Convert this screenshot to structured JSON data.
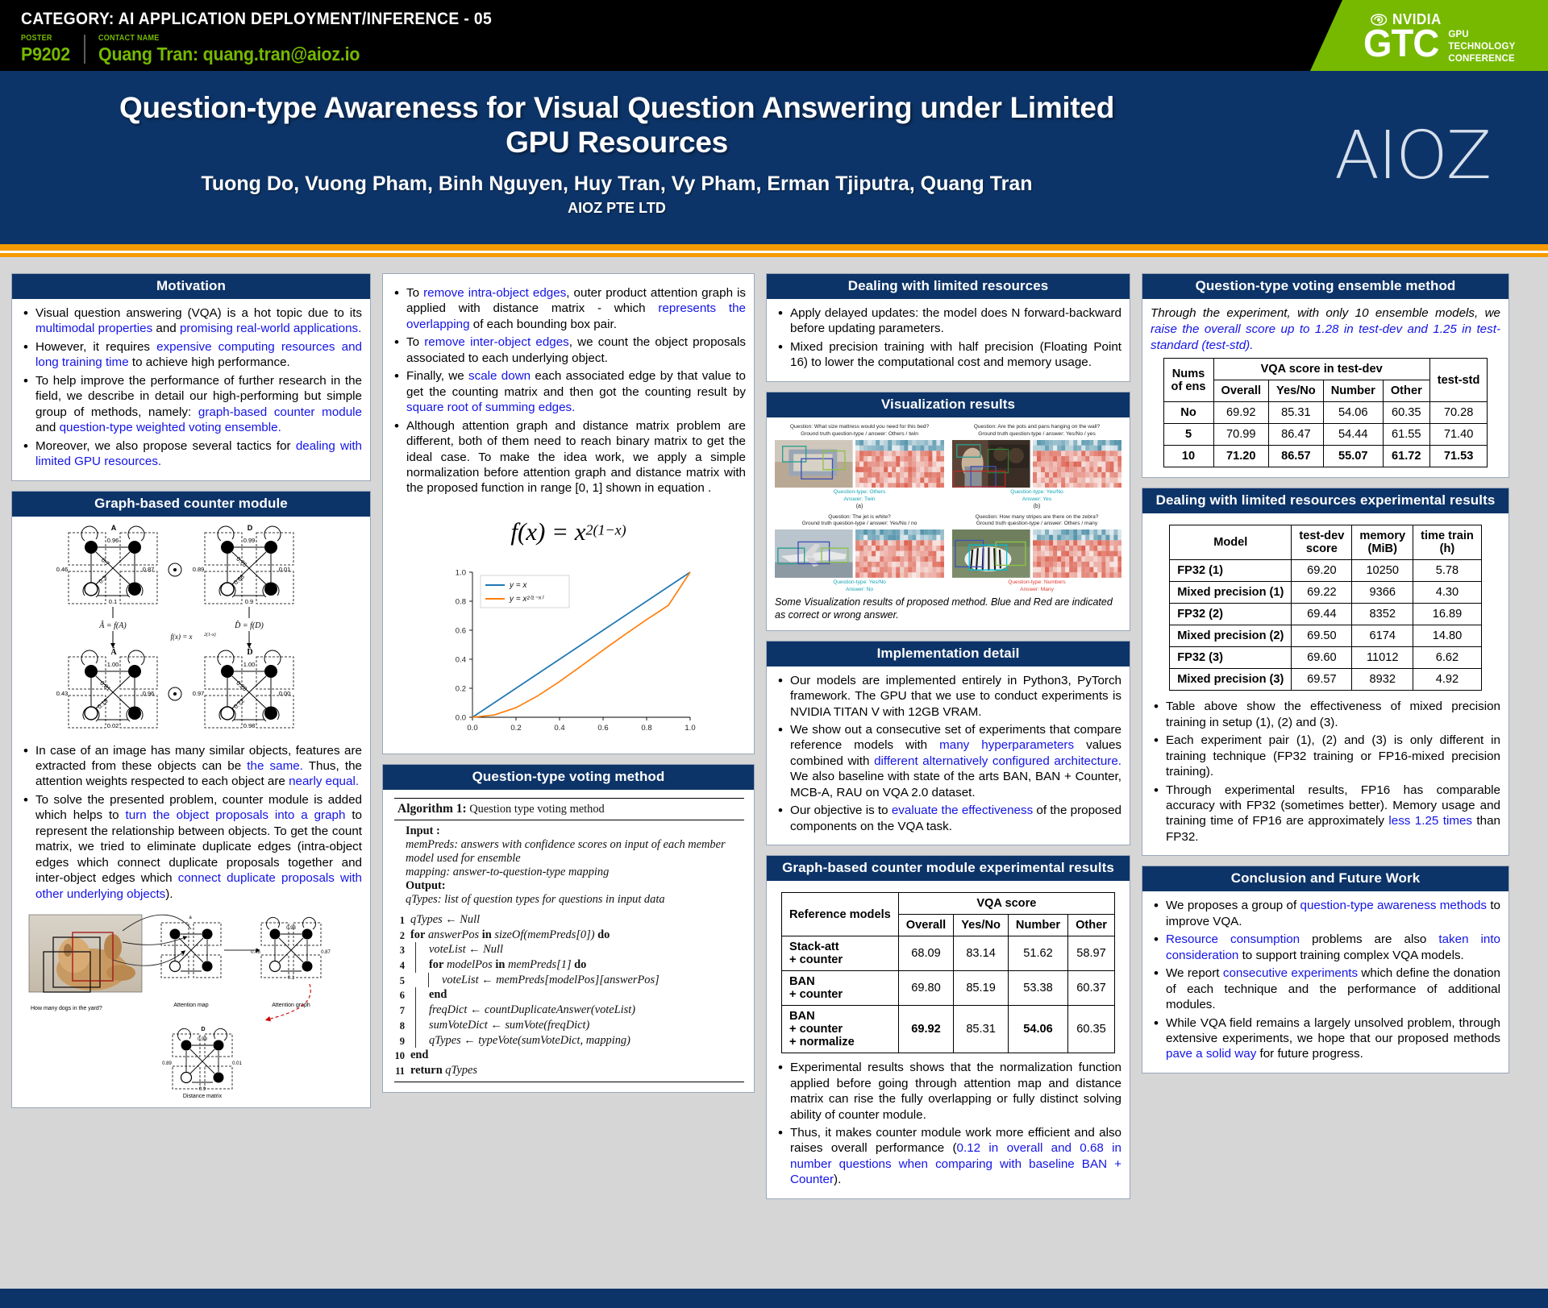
{
  "topbar": {
    "category": "CATEGORY: AI APPLICATION DEPLOYMENT/INFERENCE - 05",
    "poster_label": "POSTER",
    "poster_id": "P9202",
    "contact_label": "CONTACT NAME",
    "contact_value": "Quang Tran: quang.tran@aioz.io",
    "nvidia_wordmark": "NVIDIA",
    "gtc_letters": "GTC",
    "gtc_expand_1": "GPU",
    "gtc_expand_2": "TECHNOLOGY",
    "gtc_expand_3": "CONFERENCE",
    "green": "#76b900"
  },
  "header": {
    "title": "Question-type Awareness for Visual Question Answering under Limited GPU Resources",
    "authors": "Tuong Do, Vuong Pham, Binh Nguyen, Huy Tran, Vy Pham, Erman Tjiputra, Quang Tran",
    "affiliation": "AIOZ PTE LTD",
    "logo_text": "AIOZ",
    "navy": "#0d3468",
    "orange": "#f59b00"
  },
  "motivation": {
    "heading": "Motivation",
    "bullets": [
      [
        {
          "t": "Visual question answering (VQA) is a hot topic due to its ",
          "hl": false
        },
        {
          "t": "multimodal properties",
          "hl": true
        },
        {
          "t": " and ",
          "hl": false
        },
        {
          "t": "promising real-world applications.",
          "hl": true
        }
      ],
      [
        {
          "t": "However, it requires ",
          "hl": false
        },
        {
          "t": "expensive computing resources and long training time",
          "hl": true
        },
        {
          "t": " to achieve high performance.",
          "hl": false
        }
      ],
      [
        {
          "t": "To help improve the performance of further research in the field, we describe in detail our high-performing but simple group of methods, namely: ",
          "hl": false
        },
        {
          "t": "graph-based counter module",
          "hl": true
        },
        {
          "t": " and ",
          "hl": false
        },
        {
          "t": "question-type weighted voting ensemble.",
          "hl": true
        }
      ],
      [
        {
          "t": "Moreover, we also propose several tactics for ",
          "hl": false
        },
        {
          "t": "dealing with limited GPU resources.",
          "hl": true
        }
      ]
    ]
  },
  "counter_module": {
    "heading": "Graph-based counter module",
    "fig_top": {
      "node_A_label": "A",
      "node_D_label": "D",
      "A_weights": [
        "0.96",
        "0.46",
        "0.87",
        "0.1",
        "0.7",
        "0.3"
      ],
      "D_weights": [
        "0.99",
        "0.89",
        "0.01",
        "0.9",
        "0.76",
        "0.66"
      ],
      "fa_label": "Â = f(A)",
      "fd_label": "D̂ = f(D)",
      "fx_label": "f(x) = x",
      "fx_exp": "2(1-x)",
      "Ahat_weights": [
        "1.00",
        "0.43",
        "0.96",
        "0.02",
        "0.81",
        "0.19"
      ],
      "Dhat_weights": [
        "1.00",
        "0.97",
        "0.00",
        "0.98",
        "0.28",
        "0.72"
      ],
      "Ahat_label": "Â",
      "Dhat_label": "D̂"
    },
    "bullets": [
      [
        {
          "t": "In case of an image has many similar objects, features are extracted from these objects can be ",
          "hl": false
        },
        {
          "t": "the same.",
          "hl": true
        },
        {
          "t": " Thus, the attention weights respected to each object are ",
          "hl": false
        },
        {
          "t": "nearly equal.",
          "hl": true
        }
      ],
      [
        {
          "t": "To solve the presented problem, counter module is added which helps to ",
          "hl": false
        },
        {
          "t": "turn the object proposals into a graph",
          "hl": true
        },
        {
          "t": " to represent the relationship between objects. To get the count matrix, we tried to eliminate duplicate edges (intra-object edges which connect duplicate proposals together and inter-object edges which ",
          "hl": false
        },
        {
          "t": "connect duplicate proposals with other underlying objects",
          "hl": true
        },
        {
          "t": ").",
          "hl": false
        }
      ]
    ],
    "fig_bottom": {
      "question": "How many dogs in the yard?",
      "attention_map_label": "Attention map",
      "attention_graph_label": "Attention graph",
      "distance_matrix_label": "Distance matrix",
      "weights_am": [
        "0.98",
        "0.46",
        "0.87",
        "0.1"
      ],
      "weights_ag": [
        "0.99",
        "0.89",
        "0.01",
        "0.9"
      ]
    }
  },
  "col2_bullets": {
    "bullets": [
      [
        {
          "t": "To ",
          "hl": false
        },
        {
          "t": "remove intra-object edges",
          "hl": true
        },
        {
          "t": ", outer product attention graph  is applied with distance matrix - which ",
          "hl": false
        },
        {
          "t": "represents the overlapping",
          "hl": true
        },
        {
          "t": " of each bounding box pair.",
          "hl": false
        }
      ],
      [
        {
          "t": "To ",
          "hl": false
        },
        {
          "t": "remove inter-object edges",
          "hl": true
        },
        {
          "t": ", we count the object proposals associated to each underlying object.",
          "hl": false
        }
      ],
      [
        {
          "t": "Finally, we ",
          "hl": false
        },
        {
          "t": "scale down",
          "hl": true
        },
        {
          "t": " each associated edge by that value to get the counting matrix and then got the counting result by ",
          "hl": false
        },
        {
          "t": "square root of summing edges.",
          "hl": true
        }
      ],
      [
        {
          "t": "Although attention graph and distance matrix problem are different, both of them need to reach binary matrix to get the ideal case. To make the idea work, we apply a simple normalization before attention graph and distance matrix with the proposed function in range [0, 1] shown in equation .",
          "hl": false
        }
      ]
    ],
    "equation_base": "f(x) = x",
    "equation_exp": "2(1−x)"
  },
  "chart_data": {
    "type": "line",
    "title": "",
    "xlabel": "",
    "ylabel": "",
    "xlim": [
      0.0,
      1.0
    ],
    "ylim": [
      0.0,
      1.0
    ],
    "xticks": [
      "0.0",
      "0.2",
      "0.4",
      "0.6",
      "0.8",
      "1.0"
    ],
    "yticks": [
      "0.0",
      "0.2",
      "0.4",
      "0.6",
      "0.8",
      "1.0"
    ],
    "grid": false,
    "legend_position": "upper-left",
    "x": [
      0.0,
      0.1,
      0.2,
      0.3,
      0.4,
      0.5,
      0.6,
      0.7,
      0.8,
      0.9,
      1.0
    ],
    "series": [
      {
        "name": "y = x",
        "color": "#1f77b4",
        "values": [
          0.0,
          0.1,
          0.2,
          0.3,
          0.4,
          0.5,
          0.6,
          0.7,
          0.8,
          0.9,
          1.0
        ]
      },
      {
        "name": "y = x²⁽¹⁻ˣ⁾",
        "color": "#ff7f0e",
        "values": [
          0.0,
          0.0158,
          0.0661,
          0.1475,
          0.2462,
          0.3536,
          0.4629,
          0.5699,
          0.673,
          0.7715,
          1.0
        ]
      }
    ]
  },
  "voting_method": {
    "heading": "Question-type voting method",
    "algo_title_bold": "Algorithm 1:",
    "algo_title_rest": " Question type voting method",
    "input_label": "Input  :",
    "input_lines": [
      "memPreds: answers with confidence scores on input of each member model used for ensemble",
      "mapping: answer-to-question-type mapping"
    ],
    "output_label": "Output:",
    "output_lines": [
      "qTypes: list of question types for questions in input data"
    ],
    "lines": [
      {
        "n": "1",
        "ind": 0,
        "code": "qTypes ← Null"
      },
      {
        "n": "2",
        "ind": 0,
        "code": "for answerPos in sizeOf(memPreds[0]) do"
      },
      {
        "n": "3",
        "ind": 1,
        "code": "voteList ← Null"
      },
      {
        "n": "4",
        "ind": 1,
        "code": "for modelPos in memPreds[1] do"
      },
      {
        "n": "5",
        "ind": 2,
        "code": "voteList ← memPreds[modelPos][answerPos]"
      },
      {
        "n": "6",
        "ind": 1,
        "code": "end"
      },
      {
        "n": "7",
        "ind": 1,
        "code": "freqDict ← countDuplicateAnswer(voteList)"
      },
      {
        "n": "8",
        "ind": 1,
        "code": "sumVoteDict ← sumVote(freqDict)"
      },
      {
        "n": "9",
        "ind": 1,
        "code": "qTypes ← typeVote(sumVoteDict, mapping)"
      },
      {
        "n": "10",
        "ind": 0,
        "code": "end"
      },
      {
        "n": "11",
        "ind": 0,
        "code": "return qTypes"
      }
    ]
  },
  "limited_resources": {
    "heading": "Dealing with limited resources",
    "bullets": [
      [
        {
          "t": "Apply delayed updates:  the model does N forward-backward before updating parameters.",
          "hl": false
        }
      ],
      [
        {
          "t": "Mixed precision training with half precision (Floating Point 16) to lower the computational cost and memory usage.",
          "hl": false
        }
      ]
    ]
  },
  "visualization": {
    "heading": "Visualization results",
    "caption": "Some Visualization results of proposed method. Blue and Red are indicated as correct or wrong answer.",
    "panels": [
      {
        "id": "(a)",
        "question": "Question: What size mattress would you need for this bed?",
        "gt": "Ground truth question-type / answer: Others / twin",
        "qtype": "Question-type: Others",
        "answer": "Answer: Twin",
        "color": "teal"
      },
      {
        "id": "(b)",
        "question": "Question: Are the pots and pans hanging on the wall?",
        "gt": "Ground truth question-type / answer: Yes/No / yes",
        "qtype": "Question-type: Yes/No",
        "answer": "Answer: Yes",
        "color": "teal"
      },
      {
        "id": "(c)",
        "question": "Question: The jet is white?",
        "gt": "Ground truth question-type / answer: Yes/No / no",
        "qtype": "Question-type: Yes/No",
        "answer": "Answer: No",
        "color": "teal"
      },
      {
        "id": "(d)",
        "question": "Question: How many stripes are there on the zebra?",
        "gt": "Ground truth question-type / answer: Others / many",
        "qtype": "Question-type: Numbers",
        "answer": "Answer: Many",
        "color": "red"
      }
    ]
  },
  "implementation": {
    "heading": "Implementation detail",
    "bullets": [
      [
        {
          "t": "Our models are implemented entirely in Python3, PyTorch framework. The GPU that we use to conduct experiments is NVIDIA TITAN V with 12GB VRAM.",
          "hl": false
        }
      ],
      [
        {
          "t": "We show out a consecutive set of experiments that compare reference models with ",
          "hl": false
        },
        {
          "t": "many hyperparameters",
          "hl": true
        },
        {
          "t": " values combined with ",
          "hl": false
        },
        {
          "t": "different alternatively configured architecture.",
          "hl": true
        },
        {
          "t": " We also baseline with state of the arts BAN, BAN + Counter, MCB-A, RAU on VQA 2.0 dataset.",
          "hl": false
        }
      ],
      [
        {
          "t": "Our objective is to ",
          "hl": false
        },
        {
          "t": "evaluate the effectiveness",
          "hl": true
        },
        {
          "t": " of the proposed components on the VQA task.",
          "hl": false
        }
      ]
    ]
  },
  "counter_results": {
    "heading": "Graph-based counter module experimental results",
    "col_ref": "Reference models",
    "group_header": "VQA score",
    "sub_headers": [
      "Overall",
      "Yes/No",
      "Number",
      "Other"
    ],
    "rows": [
      {
        "model": [
          "Stack-att",
          "+  counter"
        ],
        "values": [
          "68.09",
          "83.14",
          "51.62",
          "58.97"
        ],
        "bold": []
      },
      {
        "model": [
          "BAN",
          "+ counter"
        ],
        "values": [
          "69.80",
          "85.19",
          "53.38",
          "60.37"
        ],
        "bold": []
      },
      {
        "model": [
          "BAN",
          "+ counter",
          "+ normalize"
        ],
        "values": [
          "69.92",
          "85.31",
          "54.06",
          "60.35"
        ],
        "bold": [
          0,
          2
        ]
      }
    ],
    "bullets": [
      [
        {
          "t": "Experimental results shows that the normalization function applied before going through attention map and distance matrix can rise the fully overlapping or fully distinct solving ability of counter module.",
          "hl": false
        }
      ],
      [
        {
          "t": "Thus, it makes counter module work more efficient and also raises overall performance (",
          "hl": false
        },
        {
          "t": "0.12 in overall and 0.68  in number questions when comparing with baseline BAN + Counter",
          "hl": true
        },
        {
          "t": ").",
          "hl": false
        }
      ]
    ]
  },
  "ensemble": {
    "heading": "Question-type voting ensemble method",
    "intro": [
      {
        "t": "Through the experiment, with only 10 ensemble models, we ",
        "hl": false
      },
      {
        "t": "raise the overall score up to 1.28 in test-dev and 1.25 in test-standard (test-std).",
        "hl": true
      }
    ],
    "col_nums": [
      "Nums",
      "of ens"
    ],
    "group_testdev": "VQA score in test-dev",
    "group_teststd": "test-std",
    "sub_headers": [
      "Overall",
      "Yes/No",
      "Number",
      "Other",
      "Overall"
    ],
    "rows": [
      {
        "ens": "No",
        "values": [
          "69.92",
          "85.31",
          "54.06",
          "60.35",
          "70.28"
        ],
        "bold": false
      },
      {
        "ens": "5",
        "values": [
          "70.99",
          "86.47",
          "54.44",
          "61.55",
          "71.40"
        ],
        "bold": false
      },
      {
        "ens": "10",
        "values": [
          "71.20",
          "86.57",
          "55.07",
          "61.72",
          "71.53"
        ],
        "bold": true
      }
    ]
  },
  "resource_results": {
    "heading": "Dealing with limited resources experimental results",
    "headers": [
      "Model",
      "test-dev score",
      "memory (MiB)",
      "time train (h)"
    ],
    "header_lines": [
      [
        "Model"
      ],
      [
        "test-dev",
        "score"
      ],
      [
        "memory",
        "(MiB)"
      ],
      [
        "time train",
        "(h)"
      ]
    ],
    "rows": [
      {
        "model": "FP32 (1)",
        "values": [
          "69.20",
          "10250",
          "5.78"
        ]
      },
      {
        "model": "Mixed precision (1)",
        "values": [
          "69.22",
          "9366",
          "4.30"
        ]
      },
      {
        "model": "FP32 (2)",
        "values": [
          "69.44",
          "8352",
          "16.89"
        ]
      },
      {
        "model": "Mixed precision (2)",
        "values": [
          "69.50",
          "6174",
          "14.80"
        ]
      },
      {
        "model": "FP32 (3)",
        "values": [
          "69.60",
          "11012",
          "6.62"
        ]
      },
      {
        "model": "Mixed precision (3)",
        "values": [
          "69.57",
          "8932",
          "4.92"
        ]
      }
    ],
    "bullets": [
      [
        {
          "t": "Table above show the effectiveness of mixed precision training in setup (1), (2) and (3).",
          "hl": false
        }
      ],
      [
        {
          "t": "Each experiment pair (1), (2) and (3) is only different in training technique (FP32 training or FP16-mixed precision training).",
          "hl": false
        }
      ],
      [
        {
          "t": "Through experimental results, FP16 has comparable accuracy with FP32 (sometimes better). Memory usage and training time of FP16 are approximately ",
          "hl": false
        },
        {
          "t": "less 1.25 times",
          "hl": true
        },
        {
          "t": " than FP32.",
          "hl": false
        }
      ]
    ]
  },
  "conclusion": {
    "heading": "Conclusion and Future Work",
    "bullets": [
      [
        {
          "t": "We proposes a group of ",
          "hl": false
        },
        {
          "t": "question-type awareness methods",
          "hl": true
        },
        {
          "t": " to improve VQA.",
          "hl": false
        }
      ],
      [
        {
          "t": "",
          "hl": false
        },
        {
          "t": "Resource consumption",
          "hl": true
        },
        {
          "t": " problems are also ",
          "hl": false
        },
        {
          "t": "taken into consideration",
          "hl": true
        },
        {
          "t": " to support training complex VQA models.",
          "hl": false
        }
      ],
      [
        {
          "t": "We report ",
          "hl": false
        },
        {
          "t": "consecutive experiments",
          "hl": true
        },
        {
          "t": " which define the donation of each technique and the performance of additional modules.",
          "hl": false
        }
      ],
      [
        {
          "t": "While VQA field remains a largely unsolved problem, through extensive experiments, we hope that our proposed methods ",
          "hl": false
        },
        {
          "t": "pave a solid way",
          "hl": true
        },
        {
          "t": " for future progress.",
          "hl": false
        }
      ]
    ]
  }
}
